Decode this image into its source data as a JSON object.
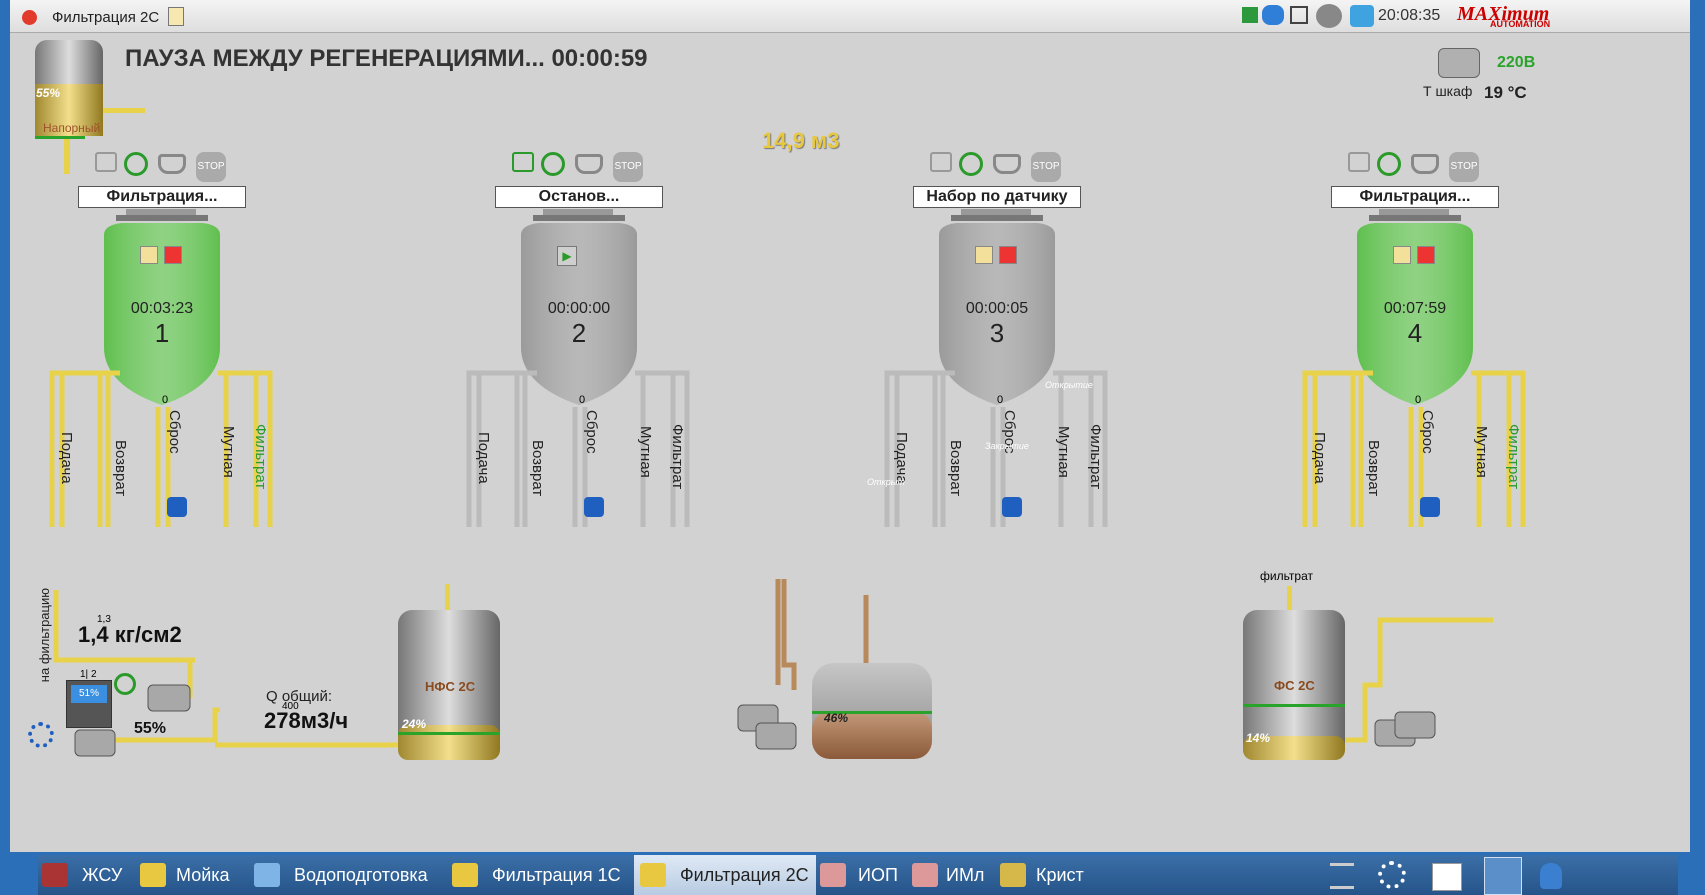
{
  "window": {
    "title": "Фильтрация 2С",
    "clock": "20:08:35",
    "logo": "MAXimum",
    "logo_sub": "AUTOMATION"
  },
  "header": {
    "status": "ПАУЗА МЕЖДУ РЕГЕНЕРАЦИЯМИ... 00:00:59",
    "total_volume": "14,9 м3"
  },
  "cabinet": {
    "voltage": "220В",
    "temp_label": "Т шкаф",
    "temp": "19 °C"
  },
  "top_tank": {
    "level": "55%",
    "label": "Напорный"
  },
  "filters": [
    {
      "status": "Фильтрация...",
      "timer": "00:03:23",
      "number": "1",
      "level": "0",
      "labels": [
        "Подача",
        "Возврат",
        "Сброс",
        "Мутная",
        "Фильтрат"
      ],
      "color": "green"
    },
    {
      "status": "Останов...",
      "timer": "00:00:00",
      "number": "2",
      "level": "0",
      "labels": [
        "Подача",
        "Возврат",
        "Сброс",
        "Мутная",
        "Фильтрат"
      ],
      "color": "grey"
    },
    {
      "status": "Набор по датчику",
      "timer": "00:00:05",
      "number": "3",
      "level": "0",
      "labels": [
        "Подача",
        "Возврат",
        "Сброс",
        "Мутная",
        "Фильтрат"
      ],
      "color": "grey",
      "valve_notes": [
        "Открыт",
        "Закрытие",
        "Открытие"
      ]
    },
    {
      "status": "Фильтрация...",
      "timer": "00:07:59",
      "number": "4",
      "level": "0",
      "labels": [
        "Подача",
        "Возврат",
        "Сброс",
        "Мутная",
        "Фильтрат"
      ],
      "color": "green"
    }
  ],
  "pump_station": {
    "vertical_label": "на фильтрацию",
    "setpoint": "1,3",
    "pressure": "1,4 кг/см2",
    "pumps": "1| 2",
    "drive": "51%",
    "speed": "55%",
    "flow_label": "Q общий:",
    "flow_setpoint": "400",
    "flow": "278м3/ч"
  },
  "nfs_tank": {
    "label": "НФС 2С",
    "level": "24%"
  },
  "mid_tank": {
    "level": "46%"
  },
  "fs_tank": {
    "label": "ФС 2С",
    "level": "14%",
    "inlet_label": "фильтрат"
  },
  "taskbar": {
    "items": [
      "ЖСУ",
      "Мойка",
      "Водоподготовка",
      "Фильтрация 1С",
      "Фильтрация 2С",
      "ИОП",
      "ИМл",
      "Крист"
    ],
    "active": "Фильтрация 2С"
  },
  "colors": {
    "green_tank": "#5fbf4d",
    "grey_tank": "#9a9a9a",
    "pipe_yellow": "#e8d24a",
    "pipe_grey": "#bbbbbb"
  }
}
